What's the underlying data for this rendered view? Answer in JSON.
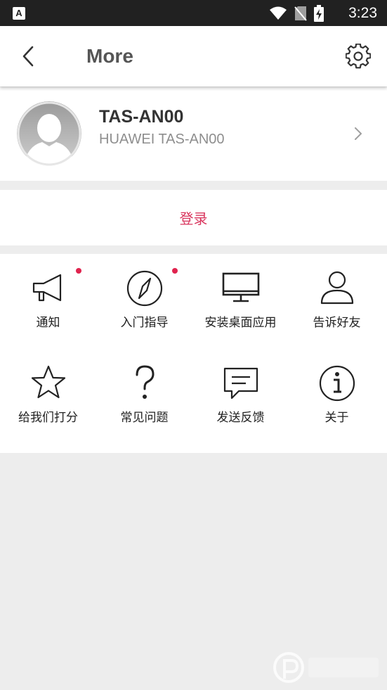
{
  "status_bar": {
    "app_icon_letter": "A",
    "time": "3:23"
  },
  "header": {
    "title": "More"
  },
  "profile": {
    "name": "TAS-AN00",
    "model": "HUAWEI TAS-AN00"
  },
  "login": {
    "label": "登录"
  },
  "grid": {
    "items": [
      {
        "label": "通知",
        "icon": "megaphone-icon",
        "badge": true
      },
      {
        "label": "入门指导",
        "icon": "compass-icon",
        "badge": true
      },
      {
        "label": "安装桌面应用",
        "icon": "monitor-icon",
        "badge": false
      },
      {
        "label": "告诉好友",
        "icon": "person-icon",
        "badge": false
      },
      {
        "label": "给我们打分",
        "icon": "star-icon",
        "badge": false
      },
      {
        "label": "常见问题",
        "icon": "question-icon",
        "badge": false
      },
      {
        "label": "发送反馈",
        "icon": "chat-icon",
        "badge": false
      },
      {
        "label": "关于",
        "icon": "info-icon",
        "badge": false
      }
    ]
  },
  "colors": {
    "accent": "#d9365e",
    "badge": "#e0234e",
    "status_bar": "#212121",
    "background": "#ededed"
  }
}
